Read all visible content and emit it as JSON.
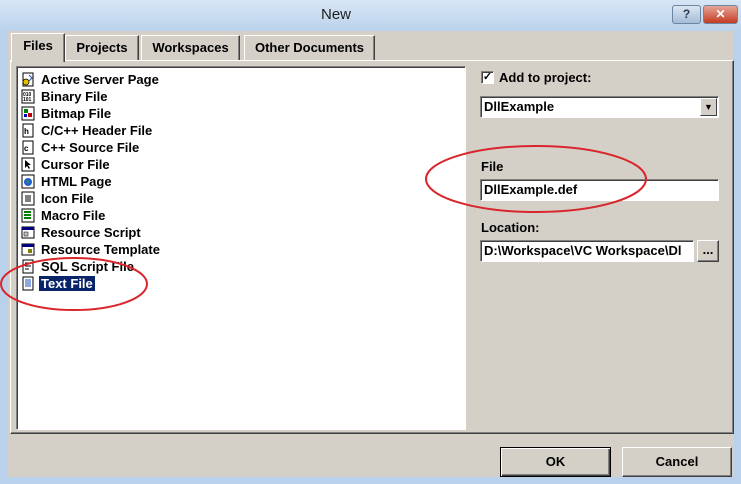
{
  "window": {
    "title": "New",
    "help_label": "?",
    "close_label": "✕"
  },
  "tabs": [
    {
      "label": "Files",
      "active": true
    },
    {
      "label": "Projects"
    },
    {
      "label": "Workspaces"
    },
    {
      "label": "Other Documents"
    }
  ],
  "file_types": [
    {
      "label": "Active Server Page",
      "icon": "asp-file-icon"
    },
    {
      "label": "Binary File",
      "icon": "binary-file-icon"
    },
    {
      "label": "Bitmap File",
      "icon": "bitmap-file-icon"
    },
    {
      "label": "C/C++ Header File",
      "icon": "header-file-icon"
    },
    {
      "label": "C++ Source File",
      "icon": "source-file-icon"
    },
    {
      "label": "Cursor File",
      "icon": "cursor-file-icon"
    },
    {
      "label": "HTML Page",
      "icon": "html-page-icon"
    },
    {
      "label": "Icon File",
      "icon": "icon-file-icon"
    },
    {
      "label": "Macro File",
      "icon": "macro-file-icon"
    },
    {
      "label": "Resource Script",
      "icon": "resource-script-icon"
    },
    {
      "label": "Resource Template",
      "icon": "resource-template-icon"
    },
    {
      "label": "SQL Script File",
      "icon": "sql-script-icon"
    },
    {
      "label": "Text File",
      "icon": "text-file-icon",
      "selected": true
    }
  ],
  "options": {
    "add_to_project_label": "Add to project:",
    "add_to_project_checked": true,
    "check_mark": "✓",
    "project_value": "DllExample",
    "dropdown_arrow": "▼",
    "file_label": "File",
    "file_value": "DllExample.def",
    "location_label": "Location:",
    "location_value": "D:\\Workspace\\VC Workspace\\Dl",
    "browse_label": "..."
  },
  "buttons": {
    "ok": "OK",
    "cancel": "Cancel"
  },
  "colors": {
    "selection": "#0a246a",
    "annotation": "#d9262c",
    "dialog_bg": "#d4d0c8"
  }
}
